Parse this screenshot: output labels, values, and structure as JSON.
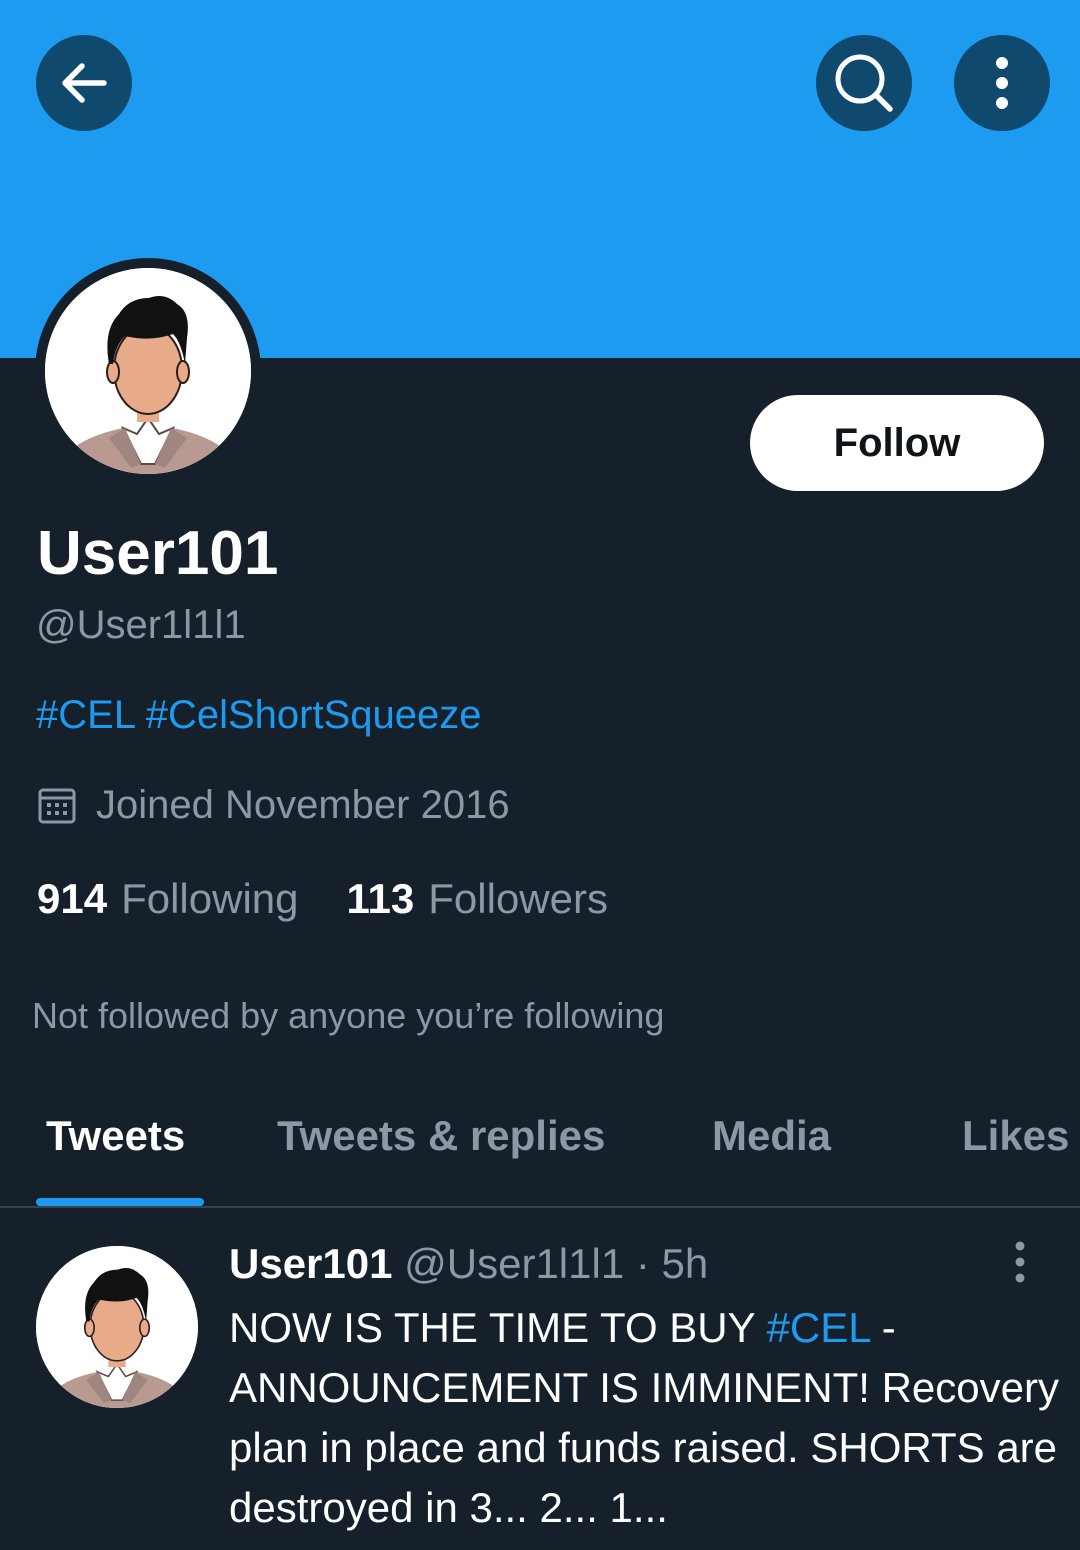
{
  "colors": {
    "accent": "#1d9bf0",
    "background": "#15202b",
    "secondary_text": "#8b98a5",
    "icon_button_bg": "#0f4a6e"
  },
  "header": {
    "back_icon": "arrow-left-icon",
    "search_icon": "search-icon",
    "more_icon": "more-vertical-icon"
  },
  "profile": {
    "display_name": "User101",
    "handle": "@User1l1l1",
    "bio_tags": [
      "#CEL",
      "#CelShortSqueeze"
    ],
    "joined_icon": "calendar-icon",
    "joined": "Joined November 2016",
    "following_count": "914",
    "following_label": "Following",
    "followers_count": "113",
    "followers_label": "Followers",
    "mutuals_note": "Not followed by anyone you’re following",
    "follow_button": "Follow"
  },
  "tabs": [
    {
      "label": "Tweets",
      "active": true
    },
    {
      "label": "Tweets & replies",
      "active": false
    },
    {
      "label": "Media",
      "active": false
    },
    {
      "label": "Likes",
      "active": false
    }
  ],
  "tweet": {
    "name": "User101",
    "handle": "@User1l1l1",
    "separator": "·",
    "time": "5h",
    "text_before_tag": "NOW IS THE TIME TO BUY ",
    "tag": "#CEL",
    "text_after_tag": " - ANNOUNCEMENT IS IMMINENT! Recovery plan in place and funds raised. SHORTS are destroyed in 3... 2... 1..."
  }
}
